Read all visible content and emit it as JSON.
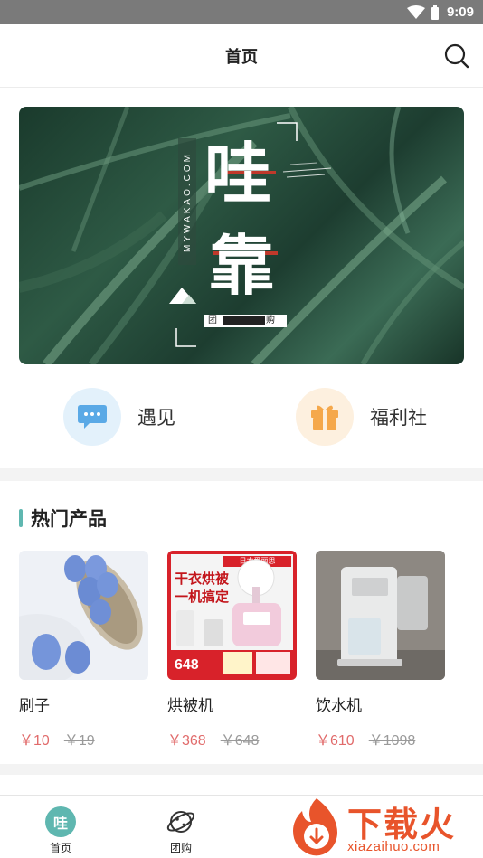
{
  "status_bar": {
    "time": "9:09"
  },
  "header": {
    "title": "首页"
  },
  "banner": {
    "site": "MYWAKAO.COM",
    "title_char_1": "哇",
    "title_char_2": "靠",
    "tag_1": "团",
    "tag_2": "购"
  },
  "quick_actions": [
    {
      "label": "遇见",
      "icon": "chat-bubble-icon",
      "bg": "#e3f1fb",
      "color": "#5aa9e6"
    },
    {
      "label": "福利社",
      "icon": "gift-icon",
      "bg": "#fdf0df",
      "color": "#f5a84b"
    }
  ],
  "hot_section": {
    "title": "热门产品"
  },
  "products": [
    {
      "name": "刷子",
      "price": "￥10",
      "old_price": "￥19"
    },
    {
      "name": "烘被机",
      "price": "￥368",
      "old_price": "￥648",
      "promo": {
        "line1": "干衣烘被",
        "line2": "一机搞定",
        "brand": "日本爱丽思",
        "price": "648"
      }
    },
    {
      "name": "饮水机",
      "price": "￥610",
      "old_price": "￥1098"
    }
  ],
  "tabbar": [
    {
      "label": "首页",
      "icon": "home-wa-icon",
      "badge": "哇",
      "active": true
    },
    {
      "label": "团购",
      "icon": "planet-icon",
      "active": false
    }
  ],
  "watermark": {
    "text": "下载火",
    "url": "xiazaihuo.com"
  },
  "colors": {
    "accent": "#5fb7b0",
    "price": "#e16b6b",
    "brand_red": "#c0392b",
    "watermark": "#e8542b"
  }
}
